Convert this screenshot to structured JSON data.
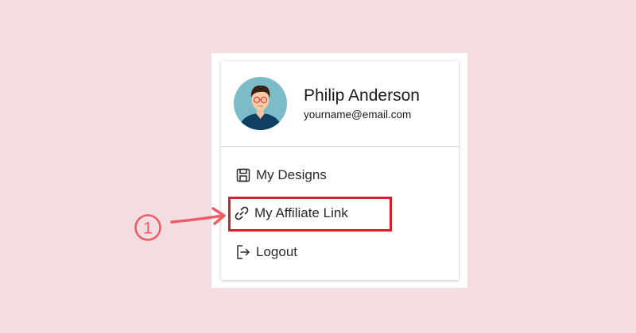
{
  "user": {
    "name": "Philip Anderson",
    "email": "yourname@email.com"
  },
  "menu": {
    "items": [
      {
        "label": "My Designs",
        "icon": "floppy-disk-icon"
      },
      {
        "label": "My Affiliate Link",
        "icon": "link-icon"
      },
      {
        "label": "Logout",
        "icon": "logout-icon"
      }
    ]
  },
  "annotation": {
    "step_label": "1",
    "highlight_color": "#d81e26",
    "arrow_color": "#ef5b66"
  },
  "colors": {
    "background": "#f4dde0",
    "avatar_bg": "#7bbcc8"
  }
}
